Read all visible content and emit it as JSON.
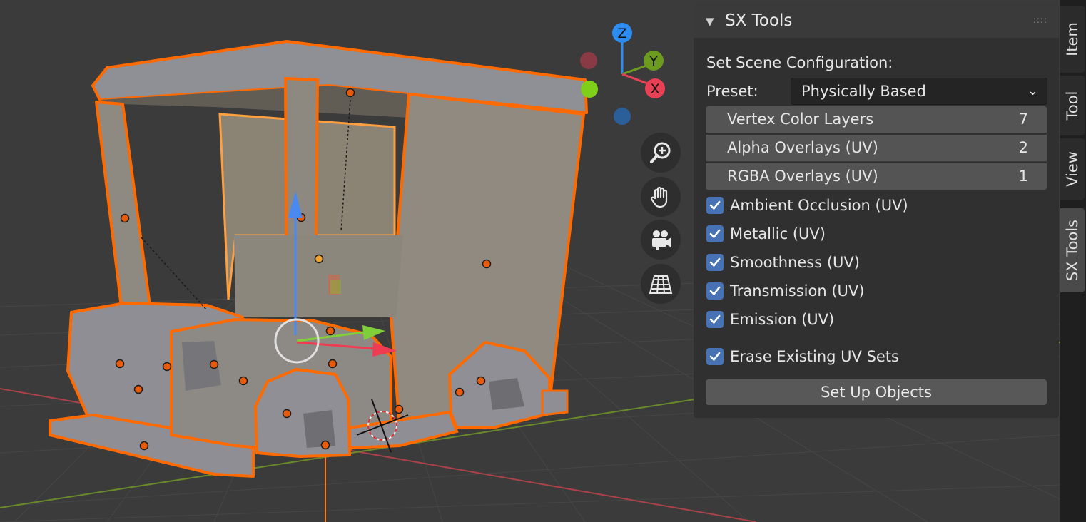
{
  "viewport": {
    "gizmo": {
      "z_label": "Z",
      "y_label": "Y",
      "x_label": "X"
    },
    "nav_buttons": [
      "zoom-icon",
      "hand-pan-icon",
      "camera-icon",
      "grid-perspective-icon"
    ]
  },
  "panel": {
    "title": "SX Tools",
    "collapse_icon": "▼",
    "drag_handle": "::::",
    "section_label": "Set Scene Configuration:",
    "preset_label": "Preset:",
    "preset_value": "Physically Based",
    "fields": [
      {
        "label": "Vertex Color Layers",
        "value": "7"
      },
      {
        "label": "Alpha Overlays (UV)",
        "value": "2"
      },
      {
        "label": "RGBA Overlays (UV)",
        "value": "1"
      }
    ],
    "checkboxes": [
      {
        "label": "Ambient Occlusion (UV)",
        "checked": true
      },
      {
        "label": "Metallic (UV)",
        "checked": true
      },
      {
        "label": "Smoothness (UV)",
        "checked": true
      },
      {
        "label": "Transmission (UV)",
        "checked": true
      },
      {
        "label": "Emission (UV)",
        "checked": true
      },
      {
        "label": "Erase Existing UV Sets",
        "checked": true
      }
    ],
    "setup_button": "Set Up Objects"
  },
  "tabs": [
    {
      "label": "Item",
      "active": false
    },
    {
      "label": "Tool",
      "active": false
    },
    {
      "label": "View",
      "active": false
    },
    {
      "label": "SX Tools",
      "active": true
    }
  ],
  "colors": {
    "accent": "#4772b3",
    "selection": "#ff6a00",
    "axis_x": "#e84155",
    "axis_y": "#6c9b20",
    "axis_z": "#2c8cf0"
  }
}
